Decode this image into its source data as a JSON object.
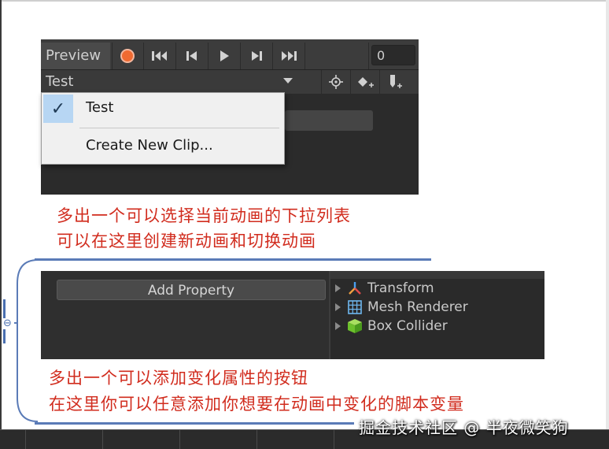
{
  "animation_toolbar": {
    "preview_label": "Preview",
    "frame_value": "0",
    "clip_selected": "Test"
  },
  "clip_dropdown": {
    "items": [
      {
        "label": "Test",
        "checked": true
      },
      {
        "label": "Create New Clip...",
        "checked": false
      }
    ]
  },
  "captions": {
    "line1": "多出一个可以选择当前动画的下拉列表",
    "line2": "可以在这里创建新动画和切换动画",
    "line3": "多出一个可以添加变化属性的按钮",
    "line4": "在这里你可以任意添加你想要在动画中变化的脚本变量"
  },
  "property_panel": {
    "add_property_label": "Add Property",
    "components": [
      {
        "label": "Transform",
        "icon": "transform-icon"
      },
      {
        "label": "Mesh Renderer",
        "icon": "mesh-renderer-icon"
      },
      {
        "label": "Box Collider",
        "icon": "box-collider-icon"
      }
    ]
  },
  "mindmap": {
    "collapse_glyph": "⊖"
  },
  "watermark": "掘金技术社区 @ 半夜微笑狗",
  "colors": {
    "caption_red": "#d12c1e",
    "bracket_blue": "#5a7bb7",
    "record_orange": "#f06a31",
    "check_highlight": "#b7d6f3"
  }
}
